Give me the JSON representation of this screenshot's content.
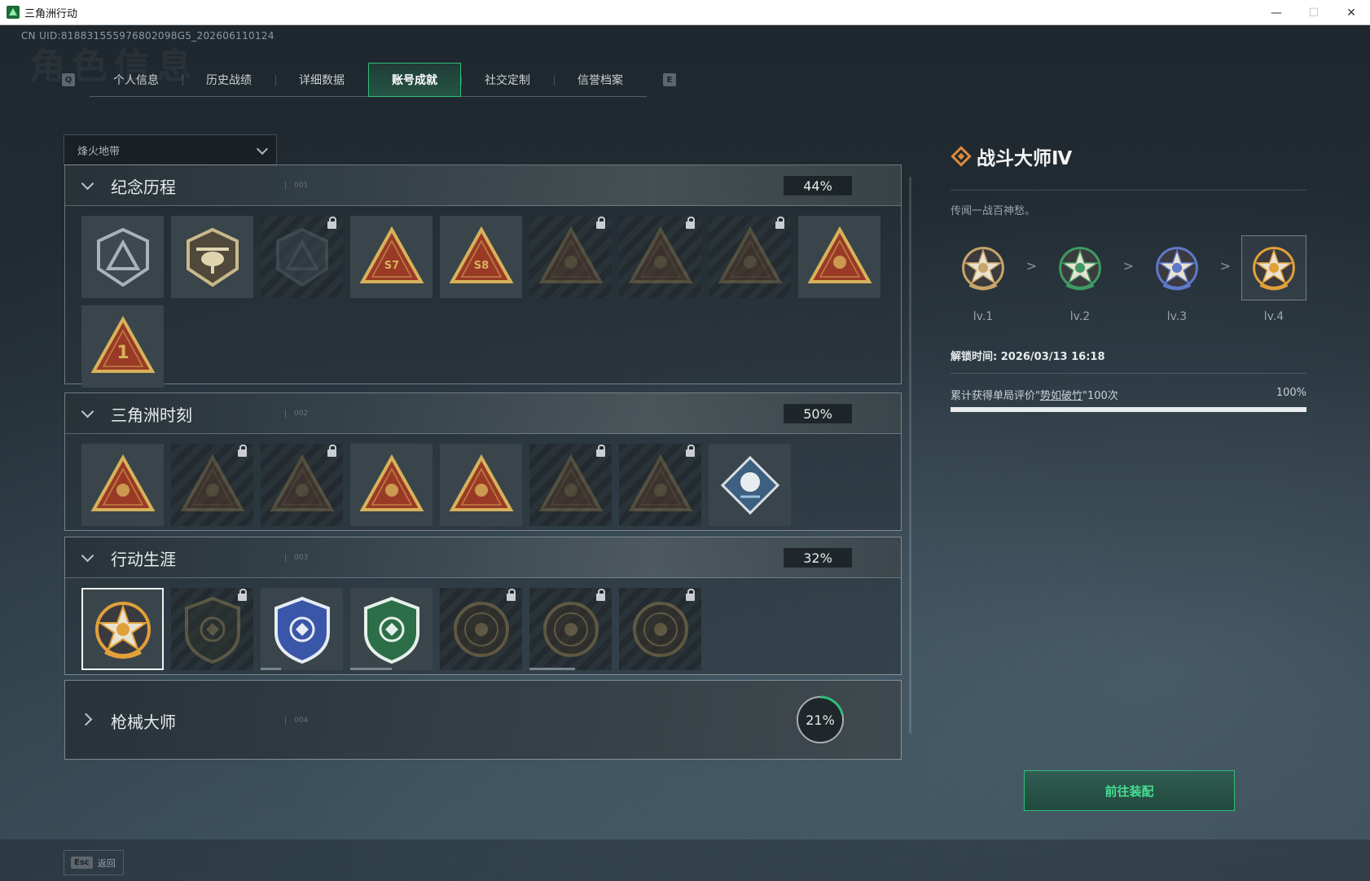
{
  "window": {
    "title": "三角洲行动"
  },
  "uid": "CN UID:818831555976802098G5_202606110124",
  "tabs": {
    "left_key": "Q",
    "right_key": "E",
    "items": [
      {
        "label": "个人信息",
        "active": false
      },
      {
        "label": "历史战绩",
        "active": false
      },
      {
        "label": "详细数据",
        "active": false
      },
      {
        "label": "账号成就",
        "active": true
      },
      {
        "label": "社交定制",
        "active": false
      },
      {
        "label": "信誉档案",
        "active": false
      }
    ]
  },
  "filter": {
    "selected": "烽火地带"
  },
  "sections": [
    {
      "name": "纪念历程",
      "num": "001",
      "percent": "44%",
      "badges": [
        {
          "icon": "delta-shield-emblem",
          "locked": false
        },
        {
          "icon": "helicopter-emblem",
          "locked": false
        },
        {
          "icon": "cyber-shield-emblem",
          "locked": true
        },
        {
          "icon": "s7-triangle-emblem",
          "locked": false,
          "text": "S7"
        },
        {
          "icon": "s8-triangle-emblem",
          "locked": false,
          "text": "S8"
        },
        {
          "icon": "mech-triangle-emblem",
          "locked": true
        },
        {
          "icon": "warrior-triangle-emblem",
          "locked": true
        },
        {
          "icon": "skull-triangle-emblem",
          "locked": true
        },
        {
          "icon": "dumpling-triangle-emblem",
          "locked": false
        },
        {
          "icon": "number-one-triangle-emblem",
          "locked": false,
          "text": "1"
        }
      ]
    },
    {
      "name": "三角洲时刻",
      "num": "002",
      "percent": "50%",
      "badges": [
        {
          "icon": "crate-triangle-emblem",
          "locked": false
        },
        {
          "icon": "robot-triangle-emblem",
          "locked": true
        },
        {
          "icon": "runner-triangle-emblem",
          "locked": true
        },
        {
          "icon": "gem-triangle-emblem",
          "locked": false
        },
        {
          "icon": "team-triangle-emblem",
          "locked": false
        },
        {
          "icon": "beast-triangle-emblem",
          "locked": true
        },
        {
          "icon": "eagle-triangle-emblem",
          "locked": true
        },
        {
          "icon": "rose-diamond-emblem",
          "locked": false
        }
      ]
    },
    {
      "name": "行动生涯",
      "num": "003",
      "percent": "32%",
      "badges": [
        {
          "icon": "star-medal-emblem",
          "locked": false,
          "selected": true
        },
        {
          "icon": "dark-shield-emblem",
          "locked": true
        },
        {
          "icon": "blue-shield-emblem",
          "locked": false,
          "progress": 0.25
        },
        {
          "icon": "green-shield-emblem",
          "locked": false,
          "progress": 0.5
        },
        {
          "icon": "spiral-round-emblem",
          "locked": true
        },
        {
          "icon": "skull-round-emblem",
          "locked": true,
          "progress": 0.55
        },
        {
          "icon": "bird-round-emblem",
          "locked": true
        }
      ]
    }
  ],
  "gun_section": {
    "name": "枪械大师",
    "num": "004",
    "percent": "21%",
    "fraction": 0.21
  },
  "detail": {
    "name": "战斗大师Ⅳ",
    "description": "传闻一战百神愁。",
    "levels": [
      {
        "label": "lv.1",
        "color": "#c7a469"
      },
      {
        "label": "lv.2",
        "color": "#3e9a62"
      },
      {
        "label": "lv.3",
        "color": "#5f78c9"
      },
      {
        "label": "lv.4",
        "color": "#e0a03a",
        "current": true
      }
    ],
    "arrow": ">",
    "unlock_time": "解锁时间: 2026/03/13 16:18",
    "requirement_prefix": "累计获得单局评价\"",
    "requirement_highlight": "势如破竹",
    "requirement_suffix": "\"100次",
    "requirement_percent": "100%",
    "requirement_progress": 1.0
  },
  "equip_button": "前往装配",
  "footer": {
    "esc_key": "Esc",
    "back": "返回"
  },
  "colors": {
    "accent": "#2fbf7a",
    "gold": "#c9a24a",
    "brand_orange": "#e08a3a"
  }
}
